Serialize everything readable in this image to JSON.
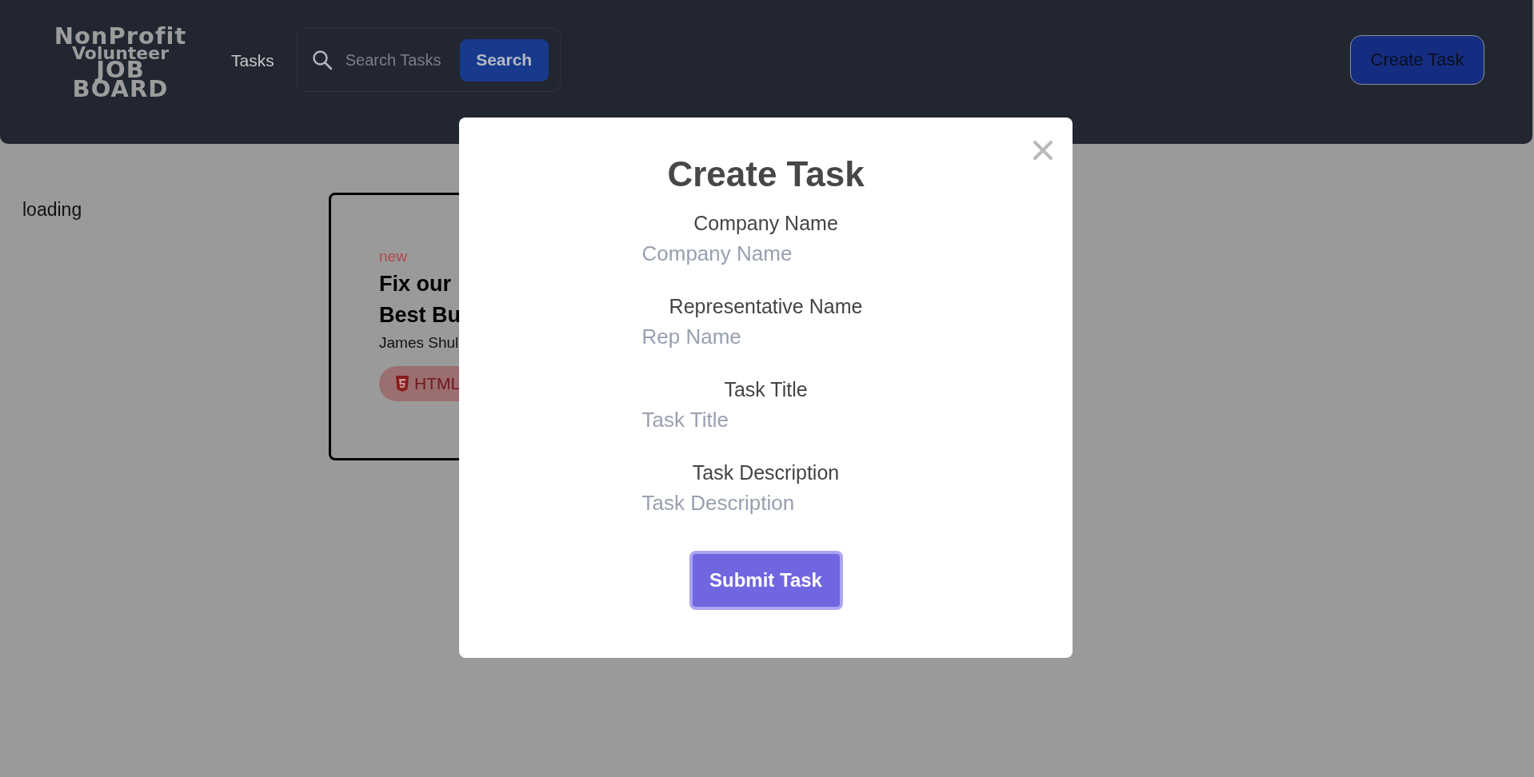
{
  "header": {
    "logo": [
      "NonProfit",
      "Volunteer",
      "JOB",
      "BOARD"
    ],
    "nav_link": "Tasks",
    "search": {
      "placeholder": "Search Tasks",
      "button": "Search"
    },
    "create_button": "Create Task"
  },
  "status": "loading",
  "task_card": {
    "badge": "new",
    "title_lines": [
      "Fix our",
      "Best Bu"
    ],
    "author": "James Shul",
    "tags": [
      {
        "label": "HTML",
        "kind": "html"
      }
    ]
  },
  "modal": {
    "title": "Create Task",
    "fields": [
      {
        "label": "Company Name",
        "placeholder": "Company Name"
      },
      {
        "label": "Representative Name",
        "placeholder": "Rep Name"
      },
      {
        "label": "Task Title",
        "placeholder": "Task Title"
      },
      {
        "label": "Task Description",
        "placeholder": "Task Description"
      }
    ],
    "submit": "Submit Task"
  }
}
